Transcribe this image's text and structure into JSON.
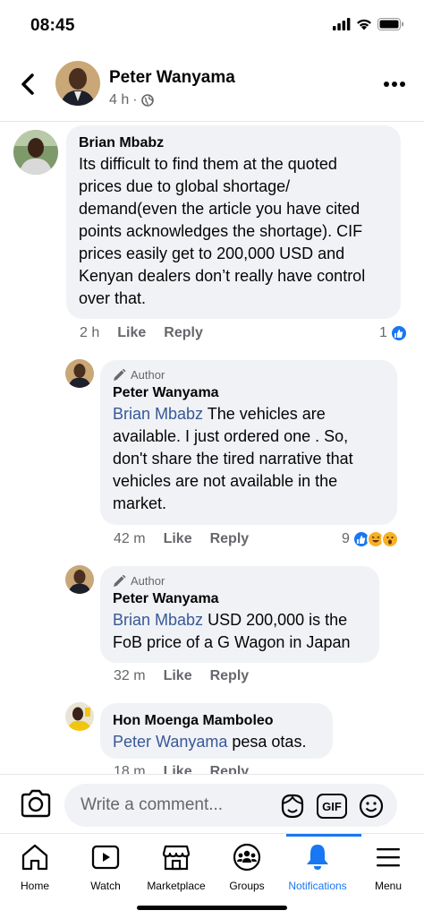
{
  "status": {
    "time": "08:45"
  },
  "header": {
    "name": "Peter Wanyama",
    "age": "4 h",
    "dot": "·"
  },
  "comments": [
    {
      "name": "Brian Mbabz",
      "lines": [
        "Its difficult to find them at the quoted",
        "prices due to global shortage/",
        "demand(even the article you have cited",
        "points acknowledges the shortage). CIF",
        "prices easily get to 200,000 USD and",
        "Kenyan dealers don’t really have control",
        "over that."
      ],
      "time": "2 h",
      "like": "Like",
      "reply": "Reply",
      "reaction_count": "1"
    },
    {
      "badge": "Author",
      "name": "Peter Wanyama",
      "mention": "Brian Mbabz",
      "first_rest": " The vehicles are",
      "lines": [
        "available.  I just ordered one . So,",
        "don't share the  tired narrative that",
        "vehicles are not available in the",
        "market."
      ],
      "time": "42 m",
      "like": "Like",
      "reply": "Reply",
      "reaction_count": "9"
    },
    {
      "badge": "Author",
      "name": "Peter Wanyama",
      "mention": "Brian Mbabz",
      "first_rest": " USD 200,000 is the",
      "lines": [
        "FoB price of a G Wagon in Japan"
      ],
      "time": "32 m",
      "like": "Like",
      "reply": "Reply"
    },
    {
      "name": "Hon Moenga Mamboleo",
      "mention": "Peter Wanyama",
      "first_rest": " pesa otas.",
      "time": "18 m",
      "like": "Like",
      "reply": "Reply"
    }
  ],
  "composer": {
    "placeholder": "Write a comment...",
    "gif": "GIF"
  },
  "tabs": [
    {
      "label": "Home",
      "icon": "home-icon"
    },
    {
      "label": "Watch",
      "icon": "watch-icon"
    },
    {
      "label": "Marketplace",
      "icon": "marketplace-icon"
    },
    {
      "label": "Groups",
      "icon": "groups-icon"
    },
    {
      "label": "Notifications",
      "icon": "bell-icon",
      "active": true
    },
    {
      "label": "Menu",
      "icon": "menu-icon"
    }
  ],
  "colors": {
    "accent": "#1877f2",
    "mention": "#385898",
    "bubble": "#f0f2f5",
    "muted": "#65676b"
  }
}
